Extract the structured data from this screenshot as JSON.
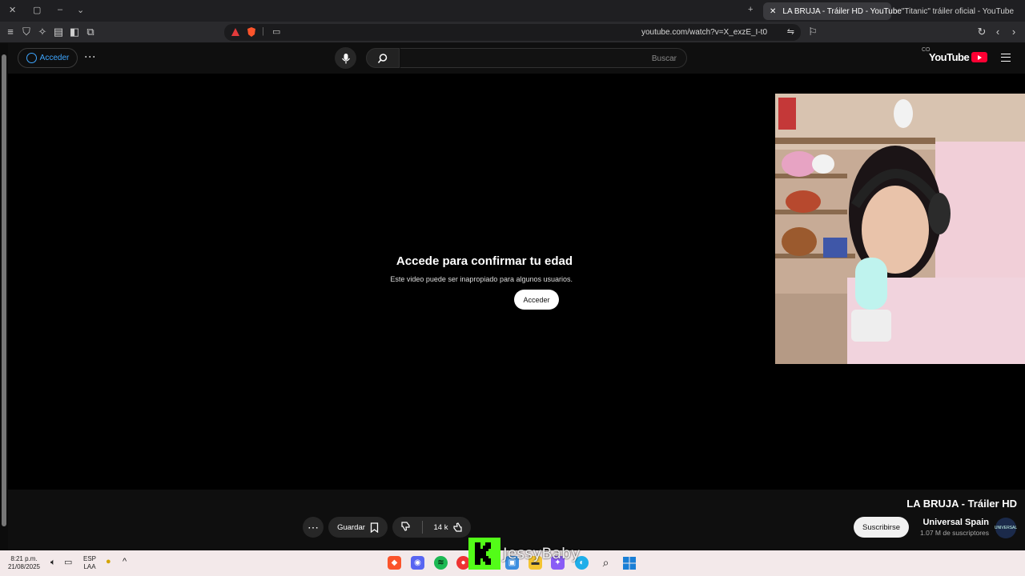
{
  "browser": {
    "tabs": [
      {
        "title": "\"Titanic\" tráiler oficial - YouTube",
        "active": false
      },
      {
        "title": "LA BRUJA - Tráiler HD - YouTube",
        "active": true
      }
    ],
    "url": "youtube.com/watch?v=X_exzE_I-t0"
  },
  "youtube": {
    "logo_text": "YouTube",
    "logo_sup": "CO",
    "search_placeholder": "Buscar",
    "signin_label": "Acceder"
  },
  "player": {
    "age_title": "Accede para confirmar tu edad",
    "age_subtitle": "Este video puede ser inapropiado para algunos usuarios.",
    "age_button": "Acceder"
  },
  "video": {
    "title": "LA BRUJA - Tráiler HD",
    "channel_name": "Universal Spain",
    "channel_subs": "1.07 M de suscriptores",
    "channel_avatar_text": "UNIVERSAL",
    "subscribe_label": "Suscribirse",
    "likes": "14 k",
    "save_label": "Guardar"
  },
  "overlay": {
    "kick_letter": "K",
    "streamer_name": "JessyBaby"
  },
  "taskbar": {
    "time": "8:21 p.m.",
    "date": "21/08/2025",
    "lang_line1": "ESP",
    "lang_line2": "LAA"
  },
  "colors": {
    "youtube_red": "#ff0033",
    "link_blue": "#3ea6ff",
    "kick_green": "#53fc18"
  }
}
